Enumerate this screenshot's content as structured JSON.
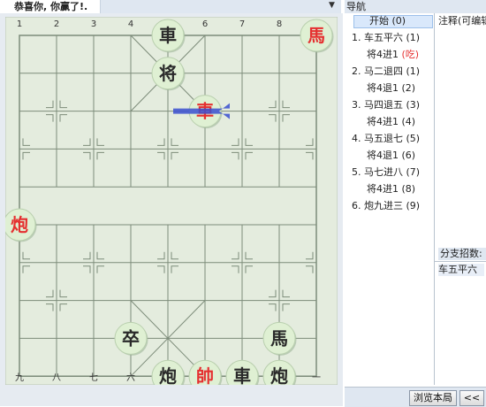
{
  "game_tab": {
    "title": "恭喜你, 你赢了!."
  },
  "board": {
    "top_files": [
      "1",
      "2",
      "3",
      "4",
      "5",
      "6",
      "7",
      "8",
      "9"
    ],
    "bottom_files": [
      "九",
      "八",
      "七",
      "六",
      "五",
      "四",
      "三",
      "二",
      "一"
    ],
    "pieces": [
      {
        "char": "車",
        "side": "black",
        "file": 5,
        "rank": 0
      },
      {
        "char": "馬",
        "side": "red",
        "file": 1,
        "rank": 0
      },
      {
        "char": "将",
        "side": "black",
        "file": 5,
        "rank": 1
      },
      {
        "char": "車",
        "side": "red",
        "file": 4,
        "rank": 2
      },
      {
        "char": "炮",
        "side": "red",
        "file": 9,
        "rank": 5
      },
      {
        "char": "卒",
        "side": "black",
        "file": 6,
        "rank": 8
      },
      {
        "char": "馬",
        "side": "black",
        "file": 2,
        "rank": 8
      },
      {
        "char": "帥",
        "side": "red",
        "file": 4,
        "rank": 9
      },
      {
        "char": "炮",
        "side": "black",
        "file": 5,
        "rank": 9
      },
      {
        "char": "車",
        "side": "black",
        "file": 3,
        "rank": 9
      },
      {
        "char": "炮",
        "side": "black",
        "file": 2,
        "rank": 9
      }
    ],
    "last_move": {
      "from_file": 5,
      "from_rank": 2,
      "to_file": 4,
      "to_rank": 2
    }
  },
  "navigation": {
    "header": "导航",
    "start": "开始 (0)",
    "moves": [
      {
        "num": "1.",
        "text": "车五平六 (1)",
        "reply": "将4进1",
        "reply_idx": "(吃)",
        "reply_red": true
      },
      {
        "num": "2.",
        "text": "马二退四 (1)",
        "reply": "将4退1",
        "reply_idx": "(2)",
        "reply_red": false
      },
      {
        "num": "3.",
        "text": "马四退五 (3)",
        "reply": "将4进1",
        "reply_idx": "(4)",
        "reply_red": false
      },
      {
        "num": "4.",
        "text": "马五退七 (5)",
        "reply": "将4退1",
        "reply_idx": "(6)",
        "reply_red": false
      },
      {
        "num": "5.",
        "text": "马七进八 (7)",
        "reply": "将4进1",
        "reply_idx": "(8)",
        "reply_red": false
      },
      {
        "num": "6.",
        "text": "炮九进三 (9)",
        "reply": "",
        "reply_idx": "",
        "reply_red": false
      }
    ]
  },
  "comment": {
    "label": "注释(可编辑"
  },
  "branch": {
    "label": "分支招数:",
    "item": "车五平六"
  },
  "buttons": {
    "browse": "浏览本局",
    "prev": "<<"
  },
  "colors": {
    "board_bg": "#e4ecde",
    "grid": "#7d8c7a",
    "piece_fill": "#dff0d3",
    "red": "#e53030",
    "black": "#2a2a2a",
    "arrow": "#3a4fd0"
  }
}
